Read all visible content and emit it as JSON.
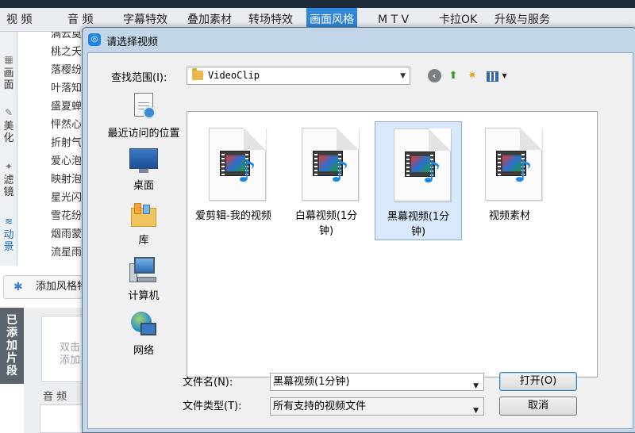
{
  "app": {
    "tabs": [
      "视 频",
      "音 频",
      "字幕特效",
      "叠加素材",
      "转场特效",
      "画面风格",
      "M T V",
      "卡拉OK",
      "升级与服务"
    ],
    "active_tab": "画面风格",
    "side_categories": [
      "画面",
      "美化",
      "滤镜",
      "动景"
    ],
    "effects": [
      "满云奠",
      "桃之夭",
      "落樱纷",
      "叶落知",
      "盛夏蝉",
      "怦然心",
      "折射气",
      "爱心泡",
      "映射泡",
      "星光闪",
      "雪花纷",
      "烟雨蒙",
      "流星雨"
    ],
    "add_style_button": "添加风格特",
    "added_clips_tab": "已添加片段",
    "dropzone_text": [
      "双击",
      "添加"
    ],
    "audio_label": "音 频"
  },
  "dialog": {
    "title": "请选择视频",
    "look_in_label": "查找范围(I):",
    "look_in_value": "VideoClip",
    "places": [
      "最近访问的位置",
      "桌面",
      "库",
      "计算机",
      "网络"
    ],
    "files": [
      {
        "name_line1": "爱剪辑-我的视频",
        "name_line2": ""
      },
      {
        "name_line1": "白幕视频(1分",
        "name_line2": "钟)"
      },
      {
        "name_line1": "黑幕视频(1分",
        "name_line2": "钟)"
      },
      {
        "name_line1": "视频素材",
        "name_line2": ""
      }
    ],
    "selected_file": "黑幕视频(1分钟)",
    "file_name_label": "文件名(N):",
    "file_name_value": "黑幕视频(1分钟)",
    "file_type_label": "文件类型(T):",
    "file_type_value": "所有支持的视频文件",
    "open_button": "打开(O)",
    "cancel_button": "取消"
  },
  "colors": {
    "active_tab": "#2f87d8",
    "selection": "#d9e9fb",
    "dialog_frame": "#c3d5e8"
  }
}
